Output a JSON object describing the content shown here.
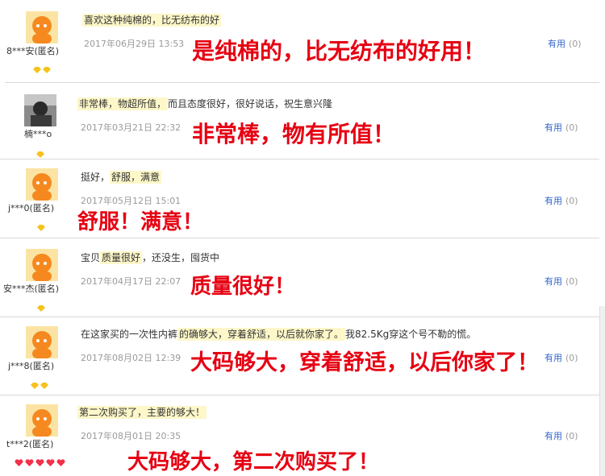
{
  "useful_label": "有用",
  "reviews": [
    {
      "user": "8***安(匿名)",
      "avatar": "orange",
      "badge": "diamond",
      "badge_count": 2,
      "comment_hl": "喜欢这种纯棉的，比无纺布的好",
      "comment_tail": "",
      "date": "2017年06月29日 13:53",
      "useful_count": "(0)",
      "caption": "是纯棉的，比无纺布的好用！"
    },
    {
      "user": "楠***o",
      "avatar": "photo",
      "badge": "diamond",
      "badge_count": 1,
      "comment_hl": "非常棒，物超所值，",
      "comment_tail": "而且态度很好，很好说话，祝生意兴隆",
      "date": "2017年03月21日 22:32",
      "useful_count": "(0)",
      "caption": "非常棒，物有所值！"
    },
    {
      "user": "j***0(匿名)",
      "avatar": "orange",
      "badge": "diamond",
      "badge_count": 1,
      "comment_pre": "挺好，",
      "comment_hl": "舒服，满意",
      "comment_tail": "",
      "date": "2017年05月12日 15:01",
      "useful_count": "(0)",
      "caption": "舒服！满意！"
    },
    {
      "user": "安***杰(匿名)",
      "avatar": "orange",
      "badge": "diamond",
      "badge_count": 1,
      "comment_pre": "宝贝",
      "comment_hl": "质量很好",
      "comment_tail": "，还没生，囤货中",
      "date": "2017年04月17日 22:07",
      "useful_count": "(0)",
      "caption": "质量很好！"
    },
    {
      "user": "j***8(匿名)",
      "avatar": "orange",
      "badge": "diamond",
      "badge_count": 2,
      "comment_pre": "在这家买的一次性内裤",
      "comment_hl": "的确够大，穿着舒适，以后就你家了。",
      "comment_tail": "我82.5Kg穿这个号不勒的慌。",
      "date": "2017年08月02日 12:39",
      "useful_count": "(0)",
      "caption": "大码够大，穿着舒适，以后你家了！"
    },
    {
      "user": "t***2(匿名)",
      "avatar": "orange",
      "badge": "heart",
      "badge_count": 5,
      "comment_hl": "第二次购买了，主要的够大！",
      "comment_tail": "",
      "date": "2017年08月01日 20:35",
      "useful_count": "(0)",
      "caption": "大码够大，第二次购买了！"
    }
  ],
  "colors": {
    "caption": "#e60012",
    "useful": "#3366cc",
    "highlight": "#fdf7c9"
  }
}
